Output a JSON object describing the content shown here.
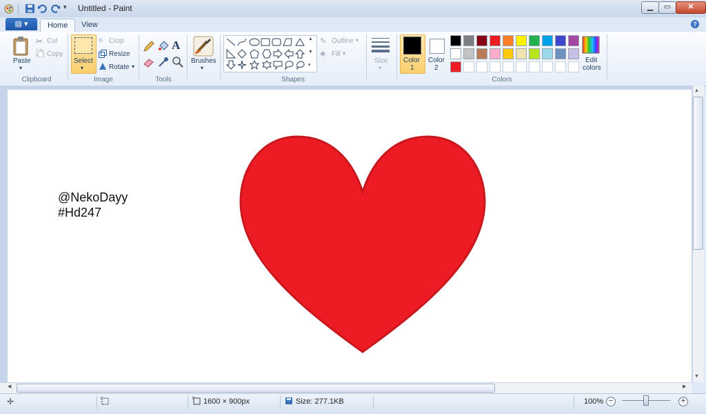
{
  "window": {
    "title": "Untitled - Paint",
    "min_label": "▁",
    "max_label": "▭",
    "close_label": "✕"
  },
  "tabs": {
    "file_label": "▤ ▾",
    "home": "Home",
    "view": "View",
    "help": "?"
  },
  "ribbon": {
    "clipboard": {
      "paste": "Paste",
      "cut": "Cut",
      "copy": "Copy",
      "group": "Clipboard"
    },
    "image": {
      "select": "Select",
      "crop": "Crop",
      "resize": "Resize",
      "rotate": "Rotate",
      "group": "Image"
    },
    "tools": {
      "group": "Tools"
    },
    "brushes": {
      "label": "Brushes"
    },
    "shapes": {
      "outline": "Outline",
      "fill": "Fill",
      "group": "Shapes"
    },
    "size": {
      "label": "Size"
    },
    "colors": {
      "color1_a": "Color",
      "color1_b": "1",
      "color2_a": "Color",
      "color2_b": "2",
      "edit_a": "Edit",
      "edit_b": "colors",
      "group": "Colors",
      "color1_value": "#000000",
      "color2_value": "#ffffff",
      "palette": [
        "#000000",
        "#7f7f7f",
        "#880015",
        "#ed1c24",
        "#ff7f27",
        "#fff200",
        "#22b14c",
        "#00a2e8",
        "#3f48cc",
        "#a349a4",
        "#ffffff",
        "#c3c3c3",
        "#b97a57",
        "#ffaec9",
        "#ffc90e",
        "#efe4b0",
        "#b5e61d",
        "#99d9ea",
        "#7092be",
        "#c8bfe7",
        "#ed1c24",
        "",
        "",
        "",
        "",
        "",
        "",
        "",
        "",
        ""
      ]
    }
  },
  "canvas": {
    "text_line1": "@NekoDayy",
    "text_line2": "#Hd247",
    "heart_color": "#ed1c24",
    "heart_outline": "#c8181e"
  },
  "status": {
    "dimensions": "1600 × 900px",
    "size": "Size: 277.1KB",
    "zoom": "100%"
  }
}
